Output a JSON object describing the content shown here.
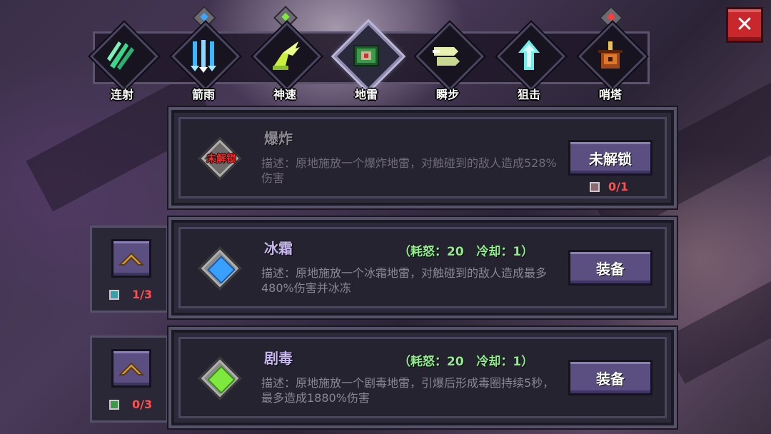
{
  "tabs": [
    {
      "label": "连射",
      "gem": "",
      "icon": "multishot-icon",
      "color": "#39d98a"
    },
    {
      "label": "箭雨",
      "gem": "#3aa8ff",
      "icon": "arrow-rain-icon",
      "color": "#3ab8ff"
    },
    {
      "label": "神速",
      "gem": "#7ee83c",
      "icon": "wing-boot-icon",
      "color": "#c8f03c"
    },
    {
      "label": "地雷",
      "gem": "",
      "icon": "landmine-icon",
      "color": "#3c9a4a"
    },
    {
      "label": "瞬步",
      "gem": "",
      "icon": "dash-icon",
      "color": "#e8f0b0"
    },
    {
      "label": "狙击",
      "gem": "",
      "icon": "sniper-arrow-icon",
      "color": "#6ef0e8"
    },
    {
      "label": "哨塔",
      "gem": "#ff3c3c",
      "icon": "turret-icon",
      "color": "#e0782c"
    }
  ],
  "active_tab": 3,
  "skills": [
    {
      "name": "爆炸",
      "stats": "",
      "desc": "描述：原地施放一个爆炸地雷，对触碰到的敌人造成528%伤害",
      "button": "未解锁",
      "locked_label": "未解锁",
      "progress": "0/1",
      "gem_color": "",
      "level": ""
    },
    {
      "name": "冰霜",
      "stats": "（耗怒：20   冷却：1）",
      "desc": "描述：原地施放一个冰霜地雷，对触碰到的敌人造成最多480%伤害并冰冻",
      "button": "装备",
      "locked_label": "",
      "progress": "",
      "gem_color": "#3aa0ff",
      "level": "1/3"
    },
    {
      "name": "剧毒",
      "stats": "（耗怒：20   冷却：1）",
      "desc": "描述：原地施放一个剧毒地雷，引爆后形成毒圈持续5秒，最多造成1880%伤害",
      "button": "装备",
      "locked_label": "",
      "progress": "",
      "gem_color": "#7ee83c",
      "level": "0/3"
    }
  ],
  "close_label": "✕",
  "colors": {
    "accent": "#5b4f82",
    "close": "#c8282c",
    "stats": "#8ef08a",
    "count": "#ff4e4e"
  }
}
